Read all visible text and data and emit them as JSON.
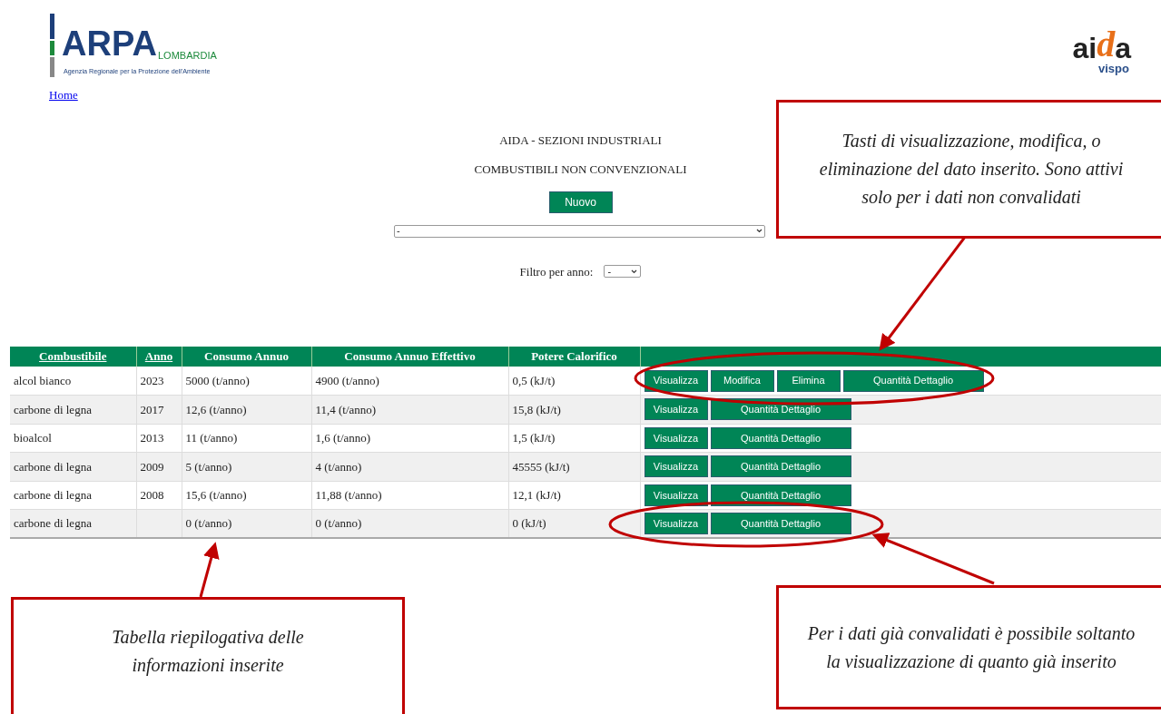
{
  "header": {
    "arpa_logo": {
      "main": "ARPA",
      "region": "LOMBARDIA",
      "tagline": "Agenzia Regionale per la Protezione dell'Ambiente"
    },
    "aida_logo": {
      "parts": [
        {
          "text": "ai",
          "color": "#222222"
        },
        {
          "text": "d",
          "color": "#e8701a"
        },
        {
          "text": "a",
          "color": "#222222"
        }
      ],
      "sub": "vispo"
    },
    "home_link": "Home"
  },
  "titles": [
    "AIDA - SEZIONI INDUSTRIALI",
    "COMBUSTIBILI NON CONVENZIONALI"
  ],
  "new_button": "Nuovo",
  "select": {
    "value": "-"
  },
  "year_filter": {
    "label": "Filtro per anno:",
    "value": "-"
  },
  "table": {
    "columns": [
      {
        "label": "Combustibile",
        "sortable": true
      },
      {
        "label": "Anno",
        "sortable": true
      },
      {
        "label": "Consumo Annuo",
        "sortable": false
      },
      {
        "label": "Consumo Annuo Effettivo",
        "sortable": false
      },
      {
        "label": "Potere Calorifico",
        "sortable": false
      }
    ],
    "rows": [
      {
        "cells": [
          "alcol bianco",
          "2023",
          "5000 (t/anno)",
          "4900 (t/anno)",
          "0,5 (kJ/t)"
        ],
        "buttons": [
          "Visualizza",
          "Modifica",
          "Elimina",
          "Quantità Dettaglio"
        ]
      },
      {
        "cells": [
          "carbone di legna",
          "2017",
          "12,6 (t/anno)",
          "11,4 (t/anno)",
          "15,8 (kJ/t)"
        ],
        "buttons": [
          "Visualizza",
          "Quantità Dettaglio"
        ]
      },
      {
        "cells": [
          "bioalcol",
          "2013",
          "11 (t/anno)",
          "1,6 (t/anno)",
          "1,5 (kJ/t)"
        ],
        "buttons": [
          "Visualizza",
          "Quantità Dettaglio"
        ]
      },
      {
        "cells": [
          "carbone di legna",
          "2009",
          "5 (t/anno)",
          "4 (t/anno)",
          "45555 (kJ/t)"
        ],
        "buttons": [
          "Visualizza",
          "Quantità Dettaglio"
        ]
      },
      {
        "cells": [
          "carbone di legna",
          "2008",
          "15,6 (t/anno)",
          "11,88 (t/anno)",
          "12,1 (kJ/t)"
        ],
        "buttons": [
          "Visualizza",
          "Quantità Dettaglio"
        ]
      },
      {
        "cells": [
          "carbone di legna",
          "",
          "0 (t/anno)",
          "0 (t/anno)",
          "0 (kJ/t)"
        ],
        "buttons": [
          "Visualizza",
          "Quantità Dettaglio"
        ]
      }
    ]
  },
  "callouts": [
    {
      "text": "Tasti di visualizzazione, modifica, o eliminazione del dato inserito. Sono attivi solo per i dati non convalidati"
    },
    {
      "text": "Tabella riepilogativa delle informazioni inserite"
    },
    {
      "text": "Per i dati già convalidati è possibile soltanto la visualizzazione di quanto già inserito"
    }
  ]
}
